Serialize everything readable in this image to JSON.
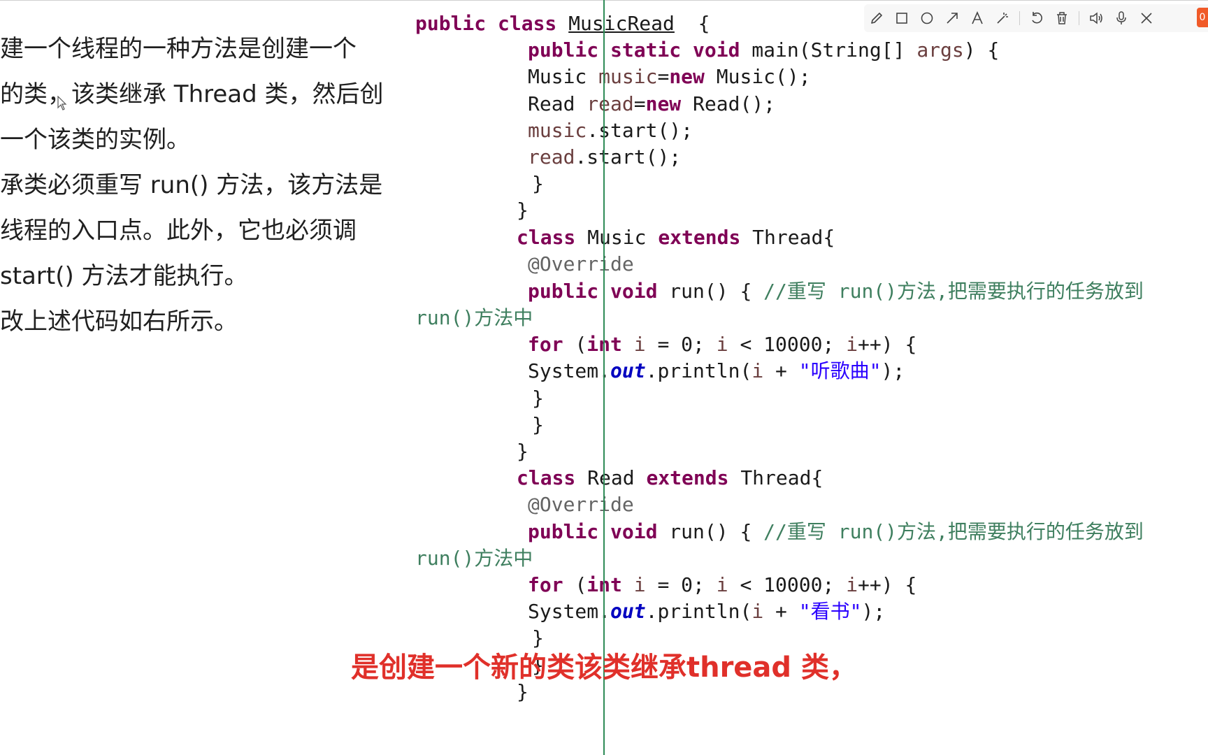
{
  "left_text": [
    "建一个线程的一种方法是创建一个",
    "的类，该类继承 Thread 类，然后创",
    "一个该类的实例。",
    "承类必须重写 run() 方法，该方法是",
    "线程的入口点。此外，它也必须调",
    "start() 方法才能执行。",
    "改上述代码如右所示。"
  ],
  "code_lines": [
    [
      [
        "kw",
        "public class "
      ],
      [
        "ul",
        "MusicRead"
      ],
      [
        "",
        "  {"
      ]
    ],
    [
      [
        "kw",
        "public static void "
      ],
      [
        "",
        "main(String[] "
      ],
      [
        "var",
        "args"
      ],
      [
        "",
        ") {"
      ]
    ],
    [
      [
        "",
        "Music "
      ],
      [
        "var",
        "music"
      ],
      [
        "",
        "="
      ],
      [
        "kw",
        "new "
      ],
      [
        "",
        "Music();"
      ]
    ],
    [
      [
        "",
        "Read "
      ],
      [
        "var",
        "read"
      ],
      [
        "",
        "="
      ],
      [
        "kw",
        "new "
      ],
      [
        "",
        "Read();"
      ]
    ],
    [
      [
        "var",
        "music"
      ],
      [
        "",
        ".start();"
      ]
    ],
    [
      [
        "var",
        "read"
      ],
      [
        "",
        ".start();"
      ]
    ],
    [
      [
        "",
        "}"
      ]
    ],
    [
      [
        "",
        "}"
      ]
    ],
    [
      [
        "kw",
        "class "
      ],
      [
        "",
        "Music "
      ],
      [
        "kw",
        "extends "
      ],
      [
        "",
        "Thread{"
      ]
    ],
    [
      [
        "ann",
        "@Override"
      ]
    ],
    [
      [
        "kw",
        "public void "
      ],
      [
        "",
        "run() { "
      ],
      [
        "cm",
        "//重写 run()方法,把需要执行的任务放到"
      ]
    ],
    [
      [
        "cm",
        "run()方法中"
      ]
    ],
    [
      [
        "kw",
        "for "
      ],
      [
        "",
        "("
      ],
      [
        "kw",
        "int "
      ],
      [
        "var",
        "i"
      ],
      [
        "",
        " = 0; "
      ],
      [
        "var",
        "i"
      ],
      [
        "",
        " < 10000; "
      ],
      [
        "var",
        "i"
      ],
      [
        "",
        "++) {"
      ]
    ],
    [
      [
        "",
        "System."
      ],
      [
        "fld",
        "out"
      ],
      [
        "",
        ".println("
      ],
      [
        "var",
        "i"
      ],
      [
        "",
        " + "
      ],
      [
        "st",
        "\"听歌曲\""
      ],
      [
        "",
        ");"
      ]
    ],
    [
      [
        "",
        "}"
      ]
    ],
    [
      [
        "",
        "}"
      ]
    ],
    [
      [
        "",
        "}"
      ]
    ],
    [
      [
        "kw",
        "class "
      ],
      [
        "",
        "Read "
      ],
      [
        "kw",
        "extends "
      ],
      [
        "",
        "Thread{"
      ]
    ],
    [
      [
        "ann",
        "@Override"
      ]
    ],
    [
      [
        "kw",
        "public void "
      ],
      [
        "",
        "run() { "
      ],
      [
        "cm",
        "//重写 run()方法,把需要执行的任务放到"
      ]
    ],
    [
      [
        "cm",
        "run()方法中"
      ]
    ],
    [
      [
        "kw",
        "for "
      ],
      [
        "",
        "("
      ],
      [
        "kw",
        "int "
      ],
      [
        "var",
        "i"
      ],
      [
        "",
        " = 0; "
      ],
      [
        "var",
        "i"
      ],
      [
        "",
        " < 10000; "
      ],
      [
        "var",
        "i"
      ],
      [
        "",
        "++) {"
      ]
    ],
    [
      [
        "",
        "System."
      ],
      [
        "fld",
        "out"
      ],
      [
        "",
        ".println("
      ],
      [
        "var",
        "i"
      ],
      [
        "",
        " + "
      ],
      [
        "st",
        "\"看书\""
      ],
      [
        "",
        ");"
      ]
    ],
    [
      [
        "",
        "}"
      ]
    ],
    [
      [
        "",
        "}"
      ]
    ],
    [
      [
        "",
        "}"
      ]
    ]
  ],
  "toolbar": {
    "recording_badge": "0"
  },
  "subtitle": "是创建一个新的类该类继承thread 类，"
}
